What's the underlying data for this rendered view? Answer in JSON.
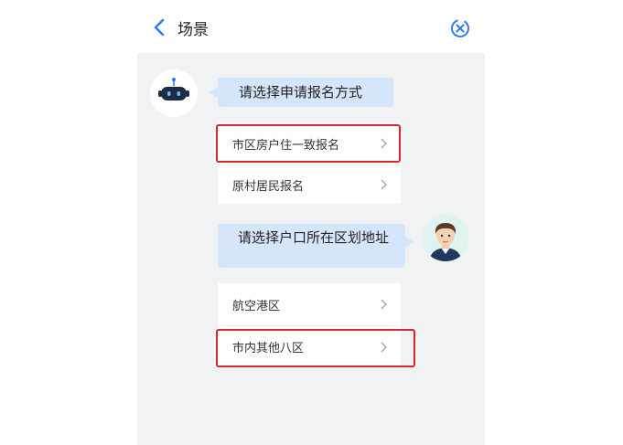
{
  "header": {
    "title": "场景",
    "back_icon": "chevron-left-icon",
    "close_icon": "close-circle-icon"
  },
  "chat": {
    "bot_message": "请选择申请报名方式",
    "bot_options": [
      {
        "label": "市区房户住一致报名",
        "highlighted": true
      },
      {
        "label": "原村居民报名",
        "highlighted": false
      }
    ],
    "user_message": "请选择户口所在区划地址",
    "user_options": [
      {
        "label": "航空港区",
        "highlighted": false
      },
      {
        "label": "市内其他八区",
        "highlighted": true
      }
    ]
  },
  "colors": {
    "accent": "#2f7cf6",
    "bubble": "#d5e6fb",
    "highlight": "#d9262b",
    "background": "#f1f2f4"
  }
}
